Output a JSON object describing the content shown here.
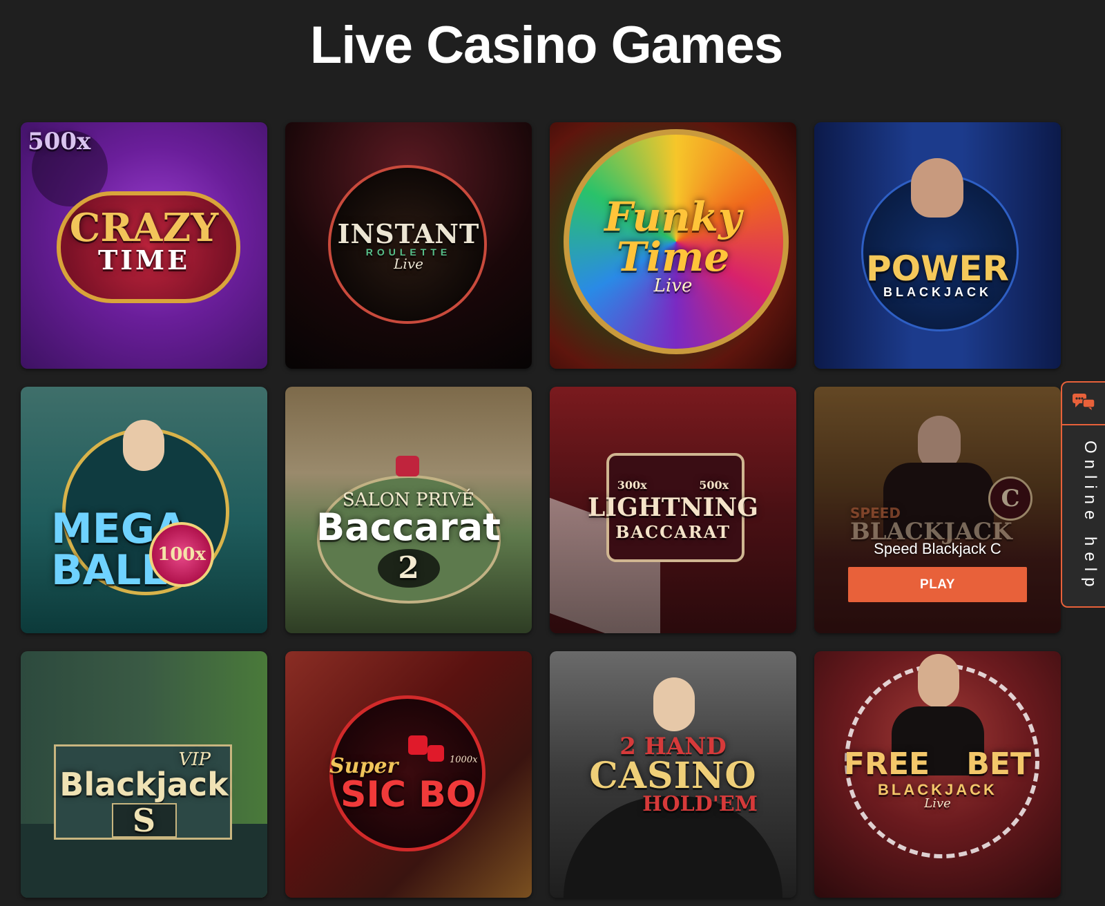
{
  "page": {
    "title": "Live Casino Games"
  },
  "games": [
    {
      "name": "Crazy Time",
      "logo": [
        "500x",
        "CRAZY",
        "TIME"
      ],
      "colors": {
        "bg1": "#7a2aa6",
        "bg2": "#3d1262",
        "text": "#f2c45a"
      }
    },
    {
      "name": "Instant Roulette Live",
      "logo": [
        "INSTANT",
        "ROULETTE",
        "Live"
      ],
      "colors": {
        "bg1": "#2d0f12",
        "bg2": "#070505",
        "text": "#e9e2d0"
      }
    },
    {
      "name": "Funky Time Live",
      "logo": [
        "Funky",
        "Time",
        "Live"
      ],
      "colors": {
        "bg1": "#f08a1d",
        "bg2": "#7a1c0e",
        "text": "#ffc43a"
      }
    },
    {
      "name": "Power Blackjack",
      "logo": [
        "POWER",
        "BLACKJACK",
        ""
      ],
      "colors": {
        "bg1": "#1c3b8c",
        "bg2": "#0a1640",
        "text": "#f4c85a"
      }
    },
    {
      "name": "Mega Ball 100x",
      "logo": [
        "MEGA",
        "BALL",
        "100x"
      ],
      "colors": {
        "bg1": "#1f5c5c",
        "bg2": "#0c2c30",
        "text": "#6fd2ff"
      }
    },
    {
      "name": "Salon Privé Baccarat 2 Live",
      "logo": [
        "SALON PRIVÉ",
        "Baccarat",
        "2"
      ],
      "colors": {
        "bg1": "#5f7a4c",
        "bg2": "#2e3d24",
        "text": "#f3ead0"
      }
    },
    {
      "name": "Lightning Baccarat",
      "logo": [
        "300x 500x",
        "LIGHTNING",
        "BACCARAT"
      ],
      "colors": {
        "bg1": "#6b1a1e",
        "bg2": "#2a0a0c",
        "text": "#f4e3c8"
      }
    },
    {
      "name": "Speed Blackjack C",
      "logo": [
        "SPEED",
        "BLACKJACK",
        "C"
      ],
      "colors": {
        "bg1": "#6a4a20",
        "bg2": "#2a1c10",
        "text": "#e9d7b6"
      },
      "hover": true,
      "play_label": "PLAY"
    },
    {
      "name": "VIP Blackjack S",
      "logo": [
        "VIP",
        "Blackjack",
        "S"
      ],
      "colors": {
        "bg1": "#2f4e4a",
        "bg2": "#13211f",
        "text": "#efe2b4"
      }
    },
    {
      "name": "Super Sic Bo",
      "logo": [
        "Super",
        "SIC BO",
        "1000x"
      ],
      "colors": {
        "bg1": "#6e1419",
        "bg2": "#2a0508",
        "text": "#f03a3a"
      }
    },
    {
      "name": "2 Hand Casino Hold'em",
      "logo": [
        "2 HAND",
        "CASINO",
        "HOLD'EM"
      ],
      "colors": {
        "bg1": "#5b5b5b",
        "bg2": "#1e1e1e",
        "text": "#efcf78"
      }
    },
    {
      "name": "Free Bet Blackjack Live",
      "logo": [
        "FREE BET",
        "BLACKJACK",
        "Live"
      ],
      "colors": {
        "bg1": "#7a1e22",
        "bg2": "#2c0a0c",
        "text": "#f3c76a"
      }
    }
  ],
  "help": {
    "label": "Online help",
    "icon": "chat-bubbles-icon",
    "accent": "#e8613a"
  }
}
